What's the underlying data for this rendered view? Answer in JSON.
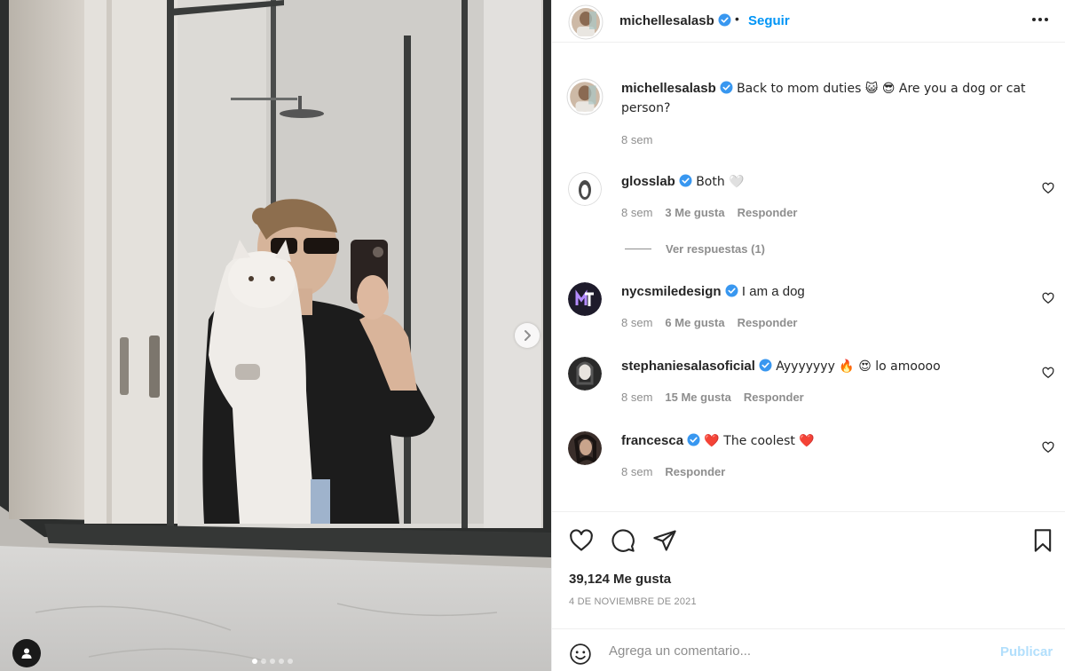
{
  "post": {
    "author": "michellesalasb",
    "follow_label": "Seguir",
    "separator": "•",
    "caption": "Back to mom duties 😺 😎 Are you a dog or cat person?",
    "caption_time": "8 sem",
    "likes": "39,124 Me gusta",
    "date": "4 DE NOVIEMBRE DE 2021",
    "carousel": {
      "count": 5,
      "active_index": 0
    }
  },
  "comments": [
    {
      "user": "glosslab",
      "text": "Both 🤍",
      "time": "8 sem",
      "likes": "3 Me gusta",
      "reply_label": "Responder",
      "view_replies": "Ver respuestas (1)"
    },
    {
      "user": "nycsmiledesign",
      "text": "I am a dog",
      "time": "8 sem",
      "likes": "6 Me gusta",
      "reply_label": "Responder"
    },
    {
      "user": "stephaniesalasoficial",
      "text": "Ayyyyyyy 🔥 😍 lo amoooo",
      "time": "8 sem",
      "likes": "15 Me gusta",
      "reply_label": "Responder"
    },
    {
      "user": "francesca",
      "text": "❤️ The coolest ❤️",
      "time": "8 sem",
      "reply_label": "Responder"
    }
  ],
  "composer": {
    "placeholder": "Agrega un comentario...",
    "publish_label": "Publicar"
  },
  "colors": {
    "accent": "#0095f6",
    "verified": "#3897f0",
    "muted": "#8e8e8e",
    "publish_disabled": "#b2dffc",
    "heart": "#ed4956"
  },
  "icons": [
    "verified-badge-icon",
    "more-options-icon",
    "heart-icon",
    "comment-icon",
    "share-icon",
    "bookmark-icon",
    "emoji-icon",
    "user-tag-icon",
    "chevron-right-icon"
  ]
}
